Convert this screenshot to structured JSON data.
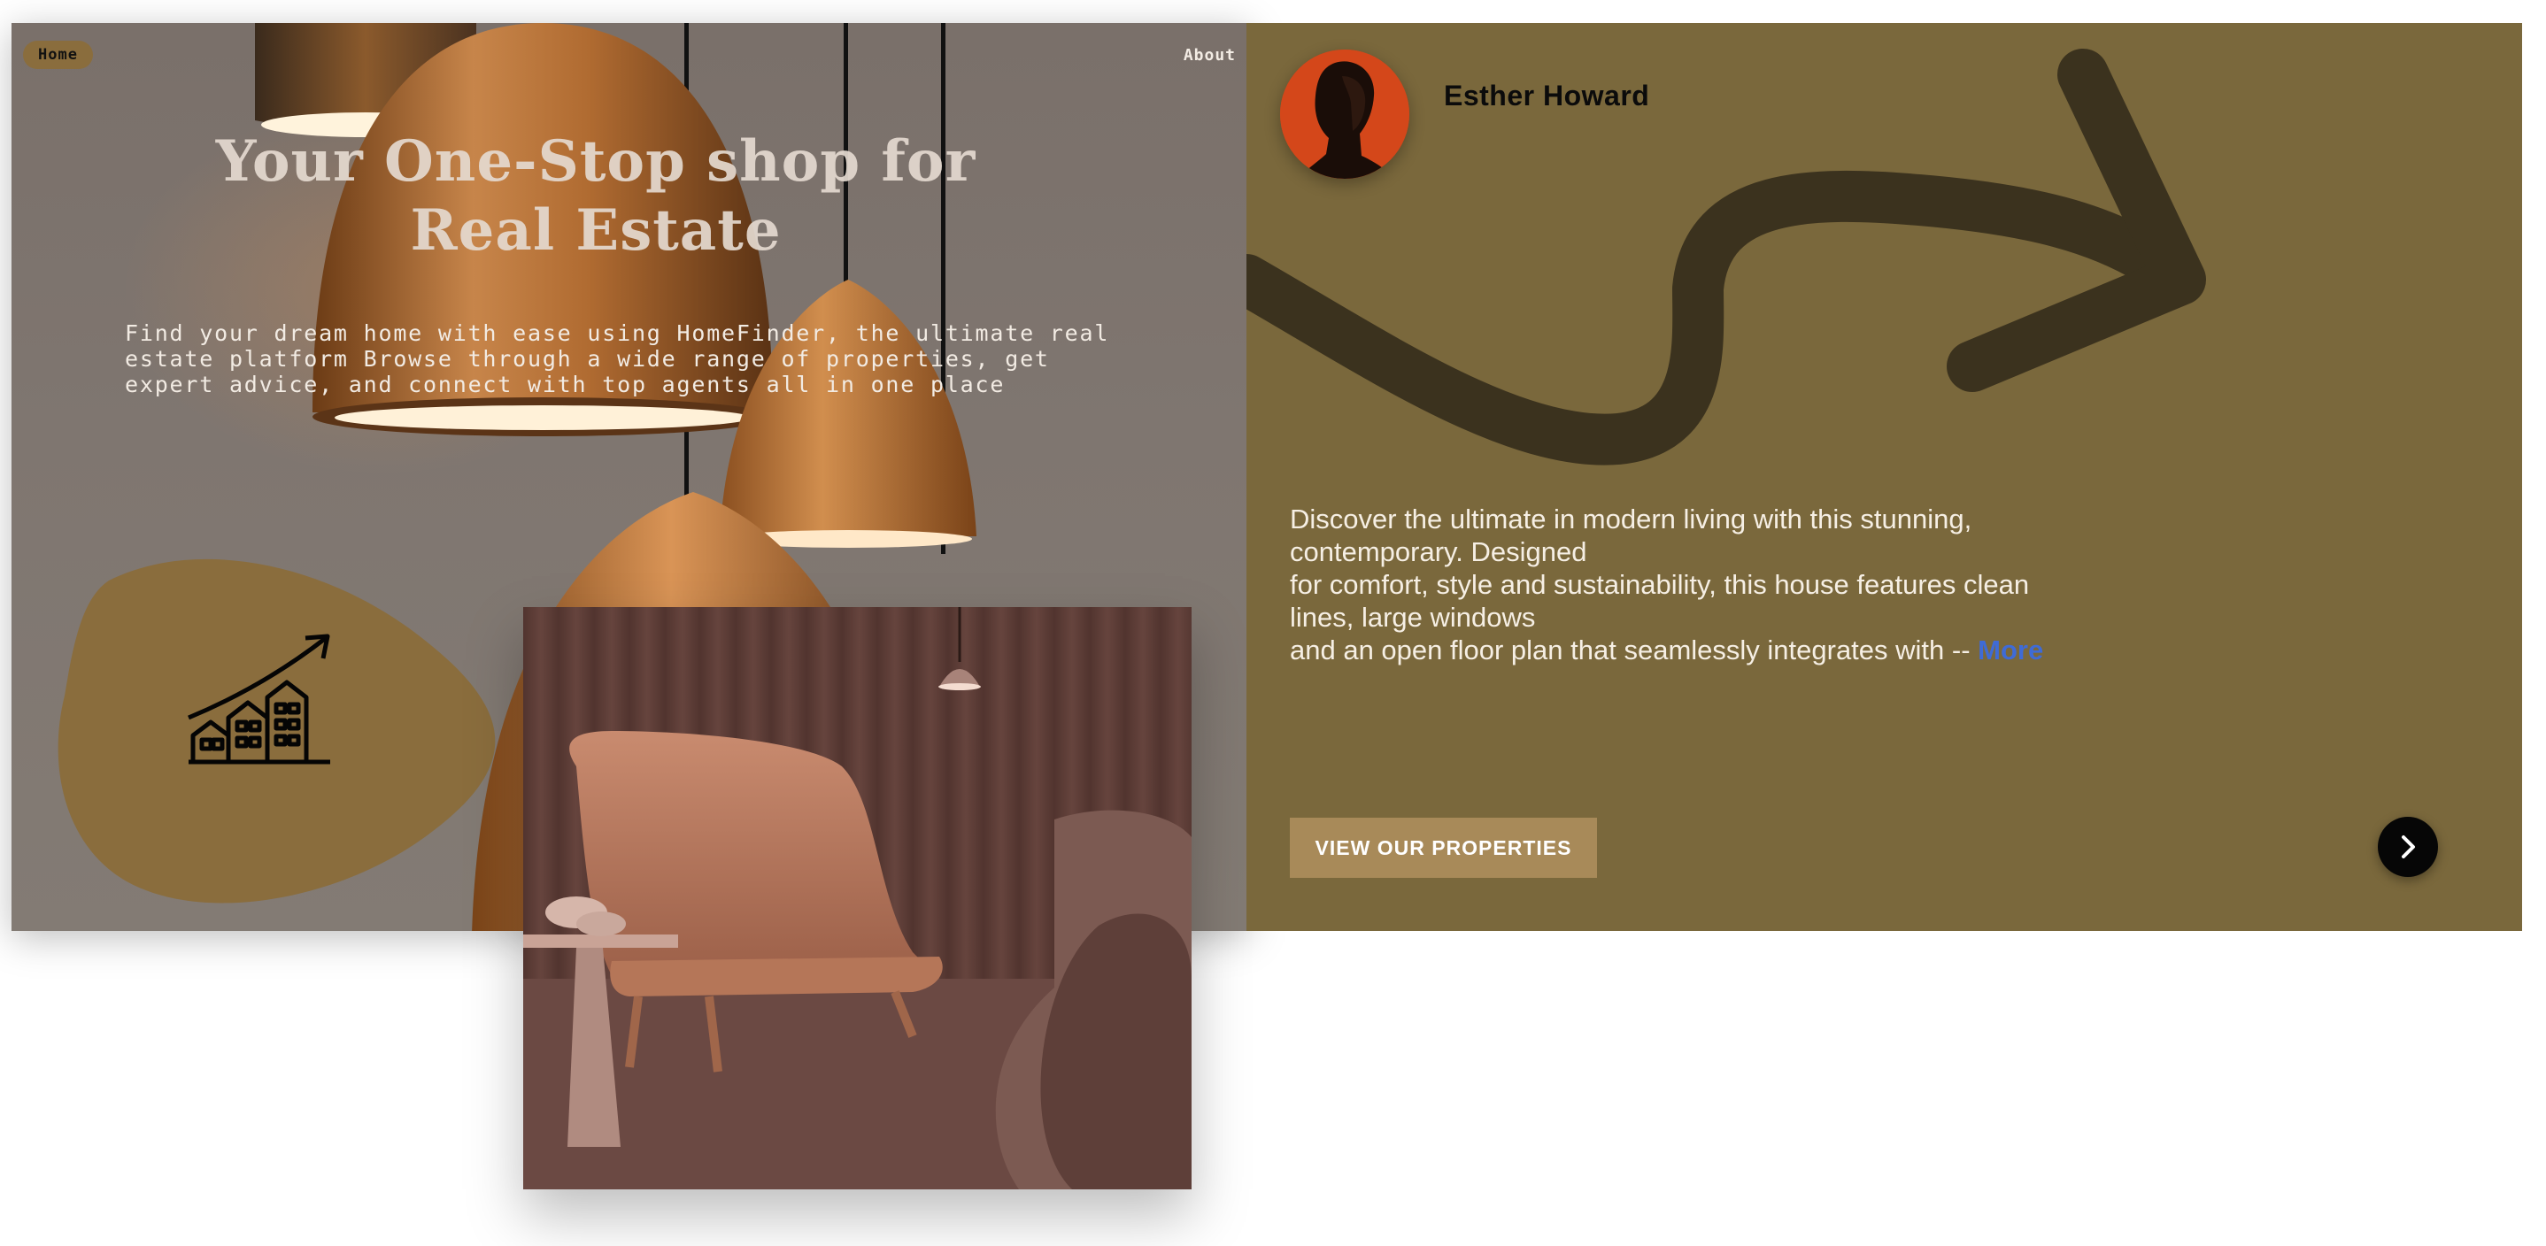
{
  "nav": {
    "home_label": "Home",
    "about_label": "About"
  },
  "hero": {
    "headline": "Your One-Stop shop for Real Estate",
    "tagline": "Find your dream home with ease using HomeFinder, the ultimate real estate platform Browse through a wide range of properties, get expert advice, and connect with top agents all in one place",
    "growth_icon": "building-growth-icon"
  },
  "agent": {
    "name": "Esther Howard",
    "avatar_icon": "avatar"
  },
  "description": {
    "line1": "Discover the ultimate in modern living with this stunning,",
    "line2": "contemporary. Designed",
    "line3": "for comfort, style and sustainability, this house features clean",
    "line4": "lines, large windows",
    "line5": "and an open floor plan that seamlessly integrates with -- ",
    "more_label": "More"
  },
  "cta": {
    "label": "VIEW OUR PROPERTIES"
  },
  "next_icon": "chevron-right-icon",
  "colors": {
    "panel": "#7a683c",
    "accent": "#a88a59",
    "blob": "#8a6d3d",
    "link": "#3f6bd6",
    "dark": "#060606"
  }
}
